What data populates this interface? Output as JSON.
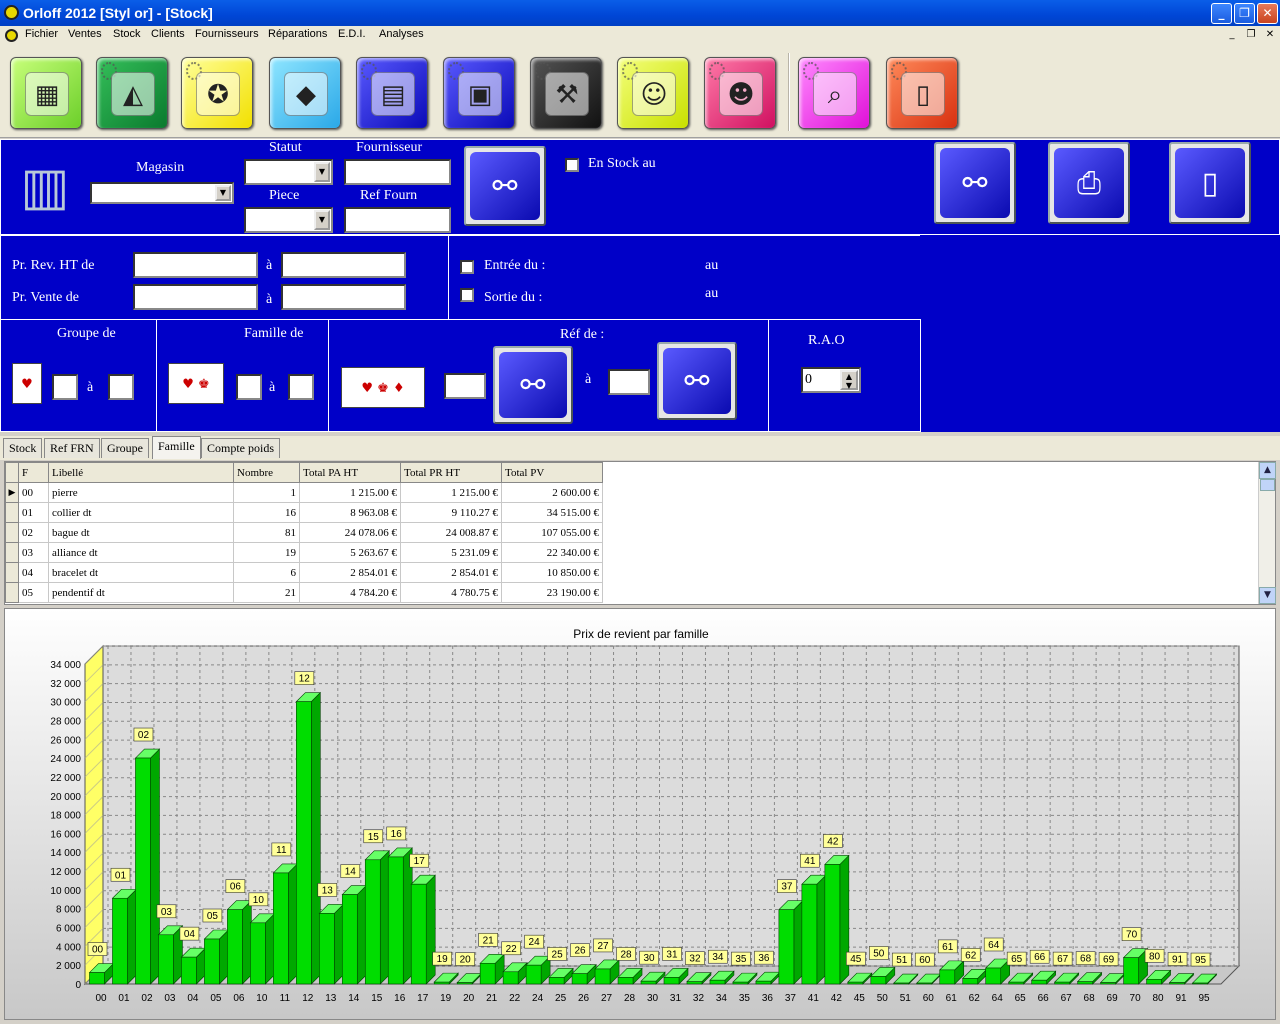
{
  "window": {
    "title": "Orloff 2012 [Styl or] - [Stock]"
  },
  "menu": [
    "Fichier",
    "Ventes",
    "Stock",
    "Clients",
    "Fournisseurs",
    "Réparations",
    "E.D.I.",
    "Analyses"
  ],
  "toolbar_icons": [
    "cash-register-icon",
    "wallet-icon",
    "gold-jewelry-icon",
    "diamond-icon",
    "clipboard-icon",
    "safe-icon",
    "toolcase-icon",
    "clients-icon",
    "users-group-icon",
    "analysis-chart-icon",
    "exit-door-icon"
  ],
  "filters": {
    "magasin_label": "Magasin",
    "statut_label": "Statut",
    "fournisseur_label": "Fournisseur",
    "piece_label": "Piece",
    "ref_fourn_label": "Ref Fourn",
    "en_stock_label": "En Stock au",
    "pr_rev_label": "Pr. Rev. HT de",
    "pr_vente_label": "Pr. Vente de",
    "a_label": "à",
    "entree_label": "Entrée du :",
    "sortie_label": "Sortie du :",
    "au_label": "au",
    "groupe_label": "Groupe de",
    "famille_label": "Famille de",
    "ref_label": "Réf de :",
    "rao_label": "R.A.O",
    "rao_value": "0"
  },
  "tabs": [
    "Stock",
    "Ref FRN",
    "Groupe",
    "Famille",
    "Compte poids"
  ],
  "active_tab": "Famille",
  "table": {
    "columns": [
      "F",
      "Libellé",
      "Nombre",
      "Total PA HT",
      "Total PR HT",
      "Total PV"
    ],
    "rows": [
      [
        "00",
        "pierre",
        "1",
        "1 215.00 €",
        "1 215.00 €",
        "2 600.00 €"
      ],
      [
        "01",
        "collier dt",
        "16",
        "8 963.08 €",
        "9 110.27 €",
        "34 515.00 €"
      ],
      [
        "02",
        "bague dt",
        "81",
        "24 078.06 €",
        "24 008.87 €",
        "107 055.00 €"
      ],
      [
        "03",
        "alliance dt",
        "19",
        "5 263.67 €",
        "5 231.09 €",
        "22 340.00 €"
      ],
      [
        "04",
        "bracelet dt",
        "6",
        "2 854.01 €",
        "2 854.01 €",
        "10 850.00 €"
      ],
      [
        "05",
        "pendentif dt",
        "21",
        "4 784.20 €",
        "4 780.75 €",
        "23 190.00 €"
      ]
    ]
  },
  "chart_data": {
    "type": "bar",
    "title": "Prix de revient par famille",
    "categories": [
      "00",
      "01",
      "02",
      "03",
      "04",
      "05",
      "06",
      "10",
      "11",
      "12",
      "13",
      "14",
      "15",
      "16",
      "17",
      "19",
      "20",
      "21",
      "22",
      "24",
      "25",
      "26",
      "27",
      "28",
      "30",
      "31",
      "32",
      "34",
      "35",
      "36",
      "37",
      "41",
      "42",
      "45",
      "50",
      "51",
      "60",
      "61",
      "62",
      "64",
      "65",
      "66",
      "67",
      "68",
      "69",
      "70",
      "80",
      "91",
      "95"
    ],
    "values": [
      1215,
      9110,
      24009,
      5231,
      2854,
      4781,
      7900,
      6500,
      11800,
      30000,
      7500,
      9500,
      13200,
      13500,
      10600,
      200,
      150,
      2200,
      1300,
      2000,
      700,
      1100,
      1600,
      700,
      300,
      700,
      250,
      400,
      200,
      300,
      7900,
      10600,
      12700,
      200,
      800,
      100,
      100,
      1500,
      600,
      1700,
      200,
      400,
      200,
      250,
      150,
      2800,
      500,
      150,
      100
    ],
    "ylim": [
      0,
      34000
    ],
    "yticks": [
      "0",
      "2 000",
      "4 000",
      "6 000",
      "8 000",
      "10 000",
      "12 000",
      "14 000",
      "16 000",
      "18 000",
      "20 000",
      "22 000",
      "24 000",
      "26 000",
      "28 000",
      "30 000",
      "32 000",
      "34 000"
    ],
    "grid": true,
    "bar_color": "#00dd00",
    "wall_color": "#ffff66"
  }
}
